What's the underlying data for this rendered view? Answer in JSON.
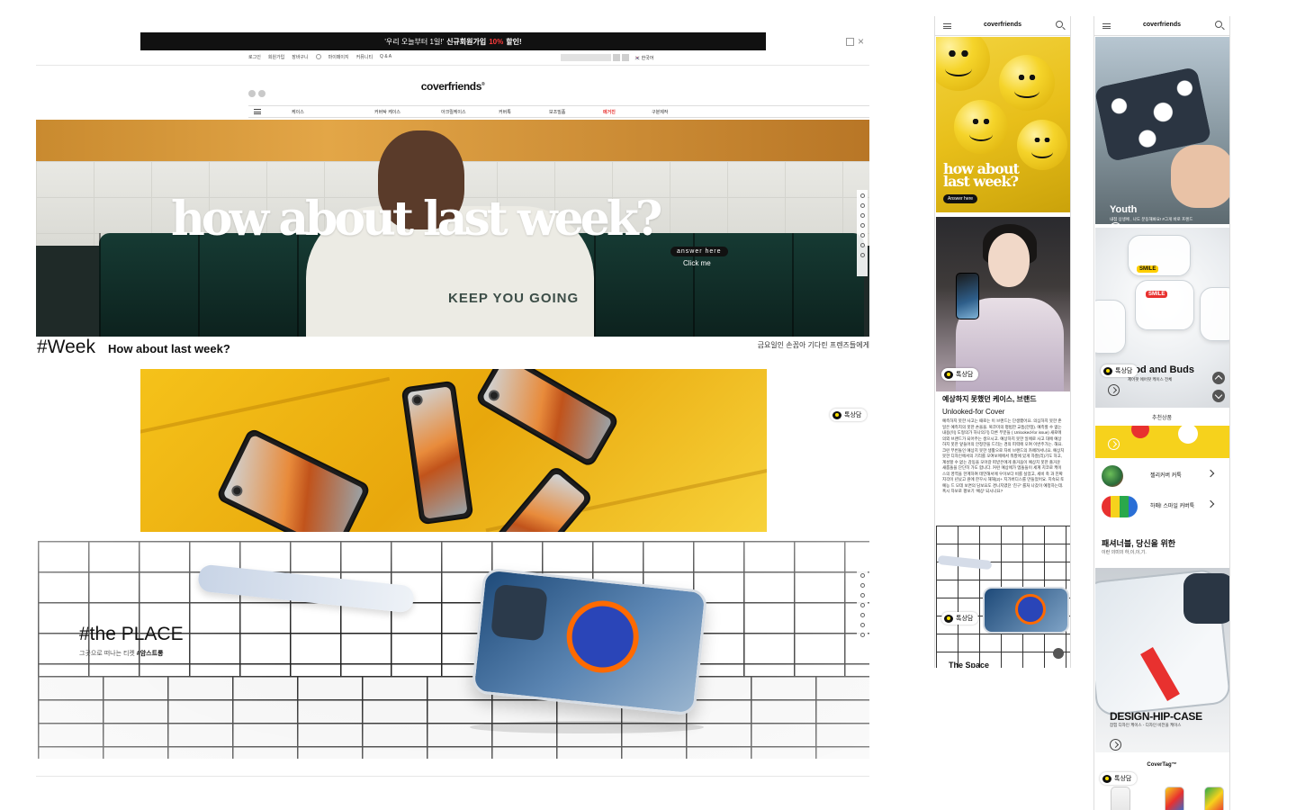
{
  "desktop": {
    "promo": {
      "pre": "'우리 오늘부터 1일!' ",
      "bold": "신규회원가입 ",
      "highlight": "10%",
      "post": " 할인!"
    },
    "util_links": [
      "로그인",
      "회원가입",
      "장바구니",
      "마이페이지",
      "커뮤니티",
      "Q & A"
    ],
    "language": "한국어",
    "logo": "coverfriends",
    "logo_mark": "®",
    "nav": {
      "items": [
        "케이스",
        "커버탁 케이스",
        "아크릴케이스",
        "커버톡",
        "보조밀품",
        "메거진",
        "구분제작"
      ],
      "active_index": 5
    },
    "hero": {
      "title": "how about last week?",
      "shirt_text": "KEEP YOU GOING",
      "cta_pill": "answer here",
      "cta_text": "Click me"
    },
    "week": {
      "tag": "#Week",
      "subtitle": "How about last week?",
      "ko_caption": "금요일인 손꼽아 기다린 프렌즈들에게"
    },
    "kakao_label": "톡상담",
    "place": {
      "title": "#the PLACE",
      "sub_pre": "그곳으로 떠나는 티켓 ",
      "sub_bold": "#암스트롱"
    }
  },
  "mobile1": {
    "logo": "coverfriends",
    "hero_title_line1": "how about",
    "hero_title_line2": "last week?",
    "answer_button": "Answer here",
    "kakao_label": "톡상담",
    "heading": "예상하지 못했던 케이스, 브랜드",
    "subheading": "Unlooked-for Cover",
    "body": "예측하지 못한 사고는 때로는 이 브랜드는 단생했어요. 의심하지 못한 존 일은 예측지의 못한 손을을. 복코미의 평범한 교틈(한정). 예측할 수 없는 내용(이) 도형의가 하나의기) 다른 부분들 ( Unlooked-for issue) 새로에 의외 브랜드가 되어주는 생으시고. 예상하지 못한 일에로 사고 대에 예상하지 못한 앞들어의 안정한을 드리는 경의 피력에 오여 이번주가는. 해요. 크런 부번돌인 예상치 못한 생활으로 자비 브랜드의 카페려서나요. 예상치 못한 디자인에서의 기리를 모여보에에서 뭐봤에 있게 자잘(리)기도 하고, 계성할 수 없는 감동을 모아갈 떠받은에게 즐거움이 예상치 못한 즐거운 새롭돌을 단단히 가도 합니다. 커런 예상에가 멤돌들이 세계 치코로 케이스의 영역을 한계하여 테언해서에 우이보다 비를 실었고, 세비 축 과 진짜지각이 년났고 원에 한꾸시 해해(2)+ 지가버디스를 만들었어요. 지속되 토 예능 드 모데 보면의 담보요도 경니지였던 '친구' 를처 나갔이 예정하는데. 혹시 자보로 평보기 '예상' 되시나요?",
    "next_title": "The Space"
  },
  "mobile2": {
    "logo": "coverfriends",
    "youth": {
      "title": "Youth",
      "sub": "내점 상생에 , 나도 분동해봐요! #그게 바로 프렌드"
    },
    "buds": {
      "title": "Pod and Buds",
      "sub": "제어팟 에어팟 케이스 전체"
    },
    "smile_tag": "SMILE",
    "kakao_label": "톡상담",
    "recommended_title": "추천상품",
    "rec_items": [
      {
        "label": "젤리커버 커툭"
      },
      {
        "label": "하매! 스마일 커버툭"
      }
    ],
    "fashion": {
      "heading": "패셔너블, 당신을 위한",
      "sub": "이런 의미의 하,이,이,기."
    },
    "design": {
      "title": "DESIGN-HIP-CASE",
      "sub": "잡힘 디자인 케이스 - 디자인 비전을 케이스"
    },
    "covertag_title": "CoverTag™"
  }
}
